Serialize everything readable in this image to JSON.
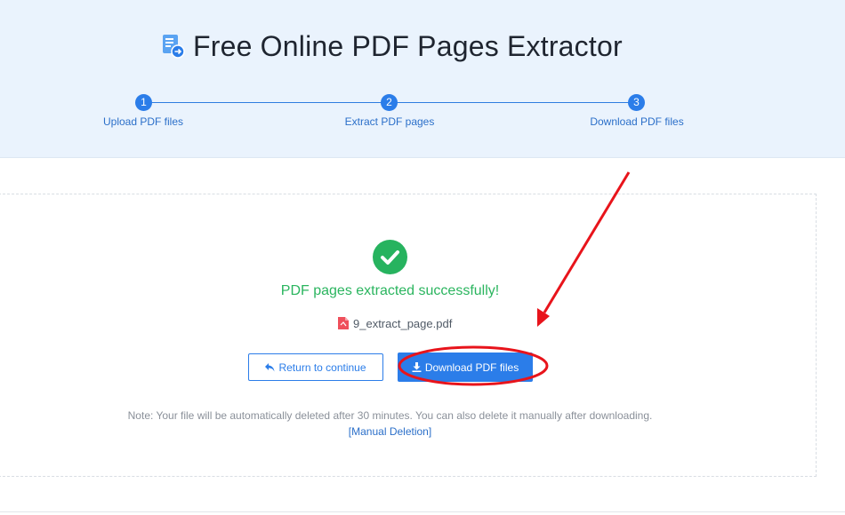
{
  "header": {
    "title": "Free Online PDF Pages Extractor",
    "logo_icon": "pdf-extract-logo-icon"
  },
  "steps": [
    {
      "number": "1",
      "label": "Upload PDF files"
    },
    {
      "number": "2",
      "label": "Extract PDF pages"
    },
    {
      "number": "3",
      "label": "Download PDF files"
    }
  ],
  "result": {
    "status_icon": "check-circle-icon",
    "success_message": "PDF pages extracted successfully!",
    "file_name": "9_extract_page.pdf",
    "file_icon": "pdf-file-icon"
  },
  "actions": {
    "return_label": "Return to continue",
    "return_icon": "return-arrow-icon",
    "download_label": "Download PDF files",
    "download_icon": "download-icon"
  },
  "note": {
    "text": "Note: Your file will be automatically deleted after 30 minutes. You can also delete it manually after downloading.",
    "manual_deletion": "[Manual Deletion]"
  },
  "colors": {
    "accent": "#2b7de9",
    "success": "#27b35f",
    "header_bg": "#eaf3fd",
    "annotation": "#e8141b"
  }
}
